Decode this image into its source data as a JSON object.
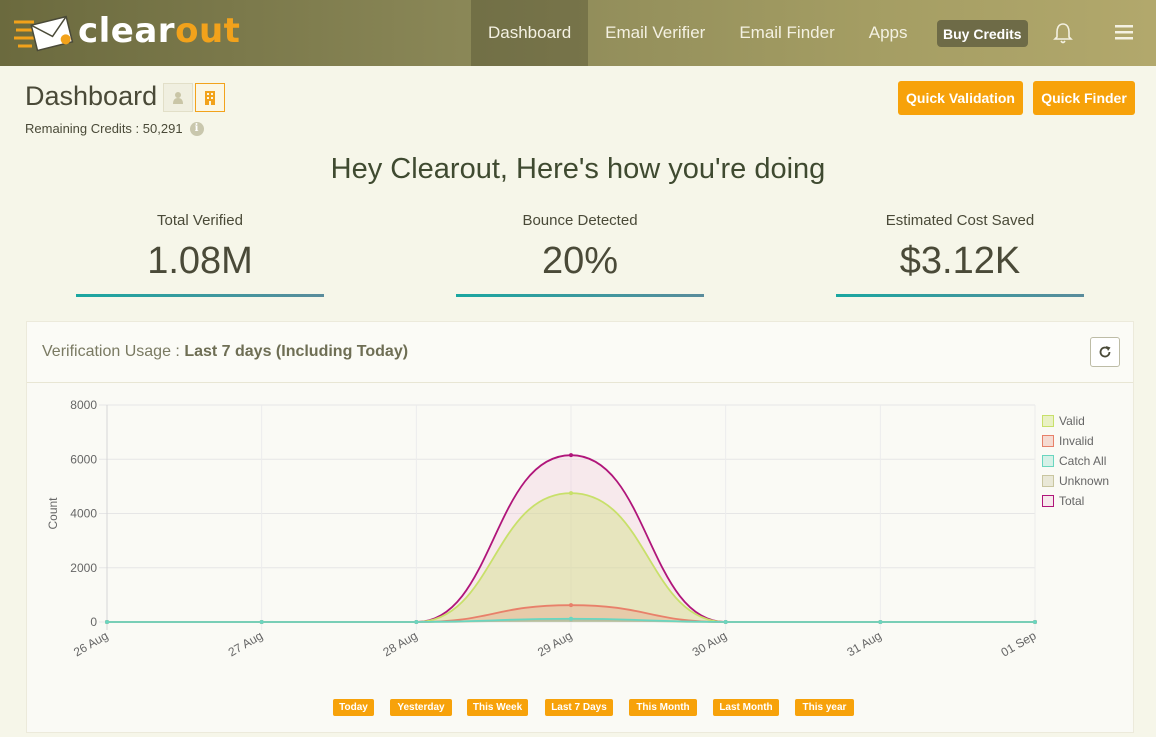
{
  "brand": {
    "part1": "clear",
    "part2": "out",
    "accent_color": "#f2a21b"
  },
  "nav": {
    "items": [
      {
        "label": "Dashboard",
        "active": true
      },
      {
        "label": "Email Verifier",
        "active": false
      },
      {
        "label": "Email Finder",
        "active": false
      },
      {
        "label": "Apps",
        "active": false
      }
    ],
    "buy_credits": "Buy Credits",
    "icons": [
      "bell-icon",
      "hamburger-menu-icon"
    ]
  },
  "header": {
    "title": "Dashboard",
    "view_toggle_icons": [
      "person-icon",
      "building-icon"
    ],
    "remaining_credits_label": "Remaining Credits :",
    "remaining_credits_value": "50,291",
    "info_icon": "i",
    "quick_validation": "Quick Validation",
    "quick_finder": "Quick Finder"
  },
  "greeting": "Hey Clearout, Here's how you're doing",
  "stats": [
    {
      "label": "Total Verified",
      "value": "1.08M"
    },
    {
      "label": "Bounce Detected",
      "value": "20%"
    },
    {
      "label": "Estimated Cost Saved",
      "value": "$3.12K"
    }
  ],
  "usage": {
    "title_prefix": "Verification Usage :",
    "title_range": "Last 7 days (Including Today)",
    "refresh_icon": "refresh-icon",
    "ranges": [
      "Today",
      "Yesterday",
      "This Week",
      "Last 7 Days",
      "This Month",
      "Last Month",
      "This year"
    ]
  },
  "chart_data": {
    "type": "area",
    "x": [
      "26 Aug",
      "27 Aug",
      "28 Aug",
      "29 Aug",
      "30 Aug",
      "31 Aug",
      "01 Sep"
    ],
    "ylabel": "Count",
    "xlabel": "",
    "ylim": [
      0,
      8000
    ],
    "yticks": [
      "0",
      "2000",
      "4000",
      "6000",
      "8000"
    ],
    "grid": true,
    "legend_position": "right",
    "series": [
      {
        "name": "Valid",
        "values": [
          0,
          0,
          0,
          4750,
          0,
          0,
          0
        ],
        "color": "#c8e06a"
      },
      {
        "name": "Invalid",
        "values": [
          0,
          0,
          0,
          620,
          0,
          0,
          0
        ],
        "color": "#e8806a"
      },
      {
        "name": "Catch All",
        "values": [
          0,
          0,
          0,
          120,
          0,
          0,
          0
        ],
        "color": "#6ad6c0"
      },
      {
        "name": "Unknown",
        "values": [
          0,
          0,
          0,
          80,
          0,
          0,
          0
        ],
        "color": "#c9c6a0"
      },
      {
        "name": "Total",
        "values": [
          0,
          0,
          0,
          6150,
          0,
          0,
          0
        ],
        "color": "#b0157a"
      }
    ]
  }
}
